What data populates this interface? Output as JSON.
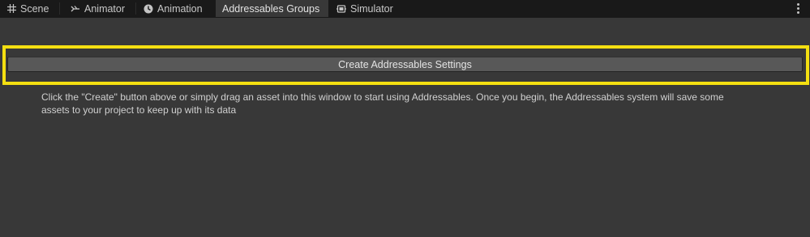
{
  "tabs": [
    {
      "label": "Scene",
      "icon": "grid-icon",
      "active": false
    },
    {
      "label": "Animator",
      "icon": "animator-icon",
      "active": false
    },
    {
      "label": "Animation",
      "icon": "clock-icon",
      "active": false
    },
    {
      "label": "Addressables Groups",
      "icon": "",
      "active": true
    },
    {
      "label": "Simulator",
      "icon": "simulator-icon",
      "active": false
    }
  ],
  "main": {
    "create_button_label": "Create Addressables Settings",
    "description_line1": "Click the \"Create\" button above or simply drag an asset into this window to start using Addressables.  Once you begin, the Addressables system will save some",
    "description_line2": "assets to your project to keep up with its data"
  },
  "colors": {
    "highlight": "#f4df11",
    "panel": "#383838",
    "tabbar": "#191919",
    "button": "#585858"
  }
}
